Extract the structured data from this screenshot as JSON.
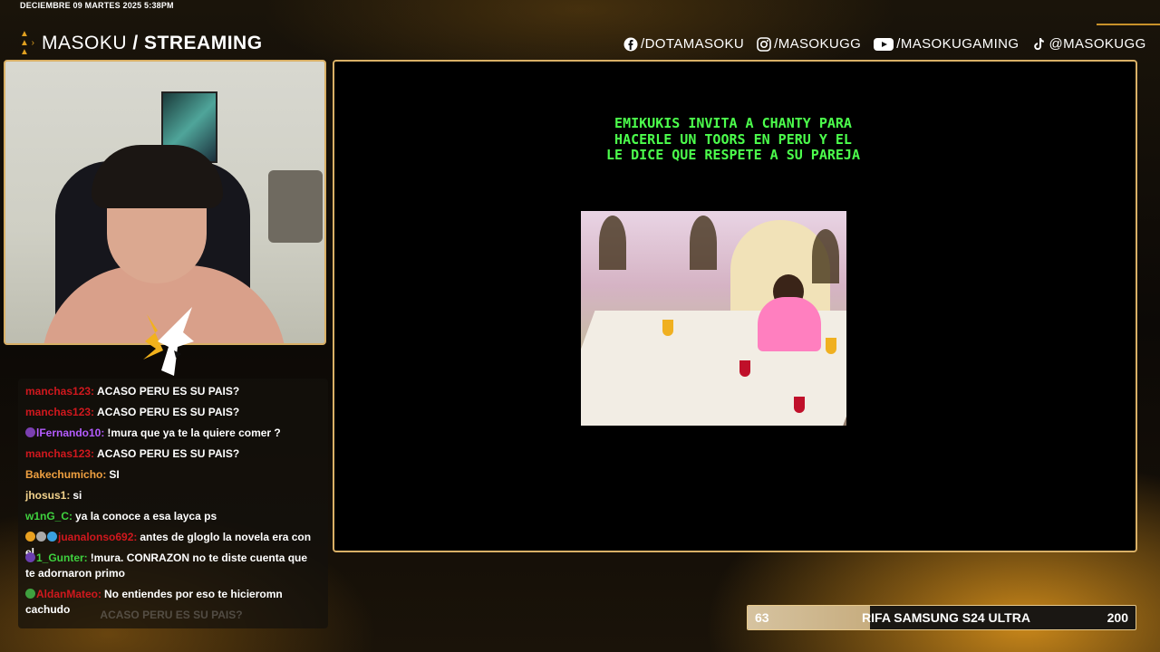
{
  "header": {
    "datetime": "DECIEMBRE 09 MARTES 2025 5:38PM",
    "brand_name": "MASOKU",
    "brand_section": "/ STREAMING"
  },
  "social": [
    {
      "icon": "facebook-icon",
      "handle": "/DOTAMASOKU"
    },
    {
      "icon": "instagram-icon",
      "handle": "/MASOKUGG"
    },
    {
      "icon": "youtube-icon",
      "handle": "/MASOKUGAMING"
    },
    {
      "icon": "tiktok-icon",
      "handle": "@MASOKUGG"
    }
  ],
  "video": {
    "caption_lines": [
      "EMIKUKIS INVITA A CHANTY PARA",
      "HACERLE UN TOORS EN PERU Y EL",
      "LE DICE QUE RESPETE A SU PAREJA"
    ]
  },
  "chat": {
    "messages": [
      {
        "user": "manchas123:",
        "user_color": "#d0181e",
        "text": "ACASO PERU ES SU PAIS?",
        "badge": ""
      },
      {
        "user": "manchas123:",
        "user_color": "#d0181e",
        "text": "ACASO PERU ES SU PAIS?",
        "badge": ""
      },
      {
        "user": "lFernando10:",
        "user_color": "#b45cff",
        "text": "!mura que ya te la quiere comer ?",
        "badge": "#7a3fb0"
      },
      {
        "user": "manchas123:",
        "user_color": "#d0181e",
        "text": "ACASO PERU ES SU PAIS?",
        "badge": ""
      },
      {
        "user": "Bakechumicho:",
        "user_color": "#f0a040",
        "text": "SI",
        "badge": ""
      },
      {
        "user": "jhosus1:",
        "user_color": "#f2d28c",
        "text": "si",
        "badge": ""
      },
      {
        "user": "w1nG_C:",
        "user_color": "#3fd13f",
        "text": "ya la conoce a esa layca ps",
        "badge": ""
      },
      {
        "user": "juanalonso692:",
        "user_color": "#d0181e",
        "text": "antes de gloglo la novela era con el",
        "badge": "#e8a020"
      },
      {
        "user": "1_Gunter:",
        "user_color": "#3fd13f",
        "text": "!mura. CONRAZON no te diste cuenta que te adornaron primo",
        "badge": "#6a3fb0"
      },
      {
        "user": "AldanMateo:",
        "user_color": "#d0181e",
        "text": "No entiendes por eso te hicieromn cachudo",
        "badge": "#3fa03f"
      },
      {
        "user": "",
        "user_color": "#888888",
        "text": "ACASO PERU ES SU PAIS?",
        "badge": ""
      }
    ]
  },
  "raffle": {
    "current": "63",
    "label": "RIFA SAMSUNG S24 ULTRA",
    "goal": "200",
    "progress": 0.315
  },
  "colors": {
    "accent_gold": "#d9b066",
    "caption_green": "#4cff4c"
  }
}
